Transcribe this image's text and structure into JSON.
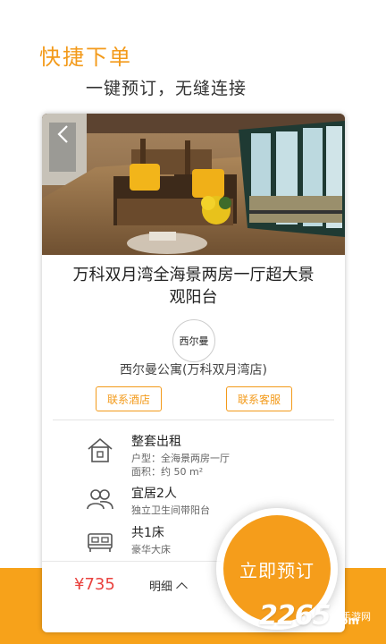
{
  "header": {
    "headline": "快捷下单",
    "subline": "一键预订，无缝连接"
  },
  "card": {
    "title_line1": "万科双月湾全海景两房一厅超大景",
    "title_line2": "观阳台",
    "hotel_logo_text": "西尔曼",
    "hotel_name": "西尔曼公寓(万科双月湾店)",
    "contact_hotel": "联系酒店",
    "contact_service": "联系客服"
  },
  "features": [
    {
      "icon": "house-icon",
      "title": "整套出租",
      "sub1": "户型：全海景两房一厅",
      "sub2": "面积：约 50 m²"
    },
    {
      "icon": "people-icon",
      "title": "宜居2人",
      "sub1": "独立卫生间带阳台",
      "sub2": ""
    },
    {
      "icon": "bed-icon",
      "title": "共1床",
      "sub1": "豪华大床",
      "sub2": ""
    }
  ],
  "bottom": {
    "price": "¥735",
    "detail_label": "明细",
    "book_now": "立即预订"
  },
  "watermark": {
    "number": "2265",
    "suffix": ".com",
    "site_cn": "手游网"
  },
  "colors": {
    "accent": "#f39a1a",
    "price": "#e9423e"
  }
}
